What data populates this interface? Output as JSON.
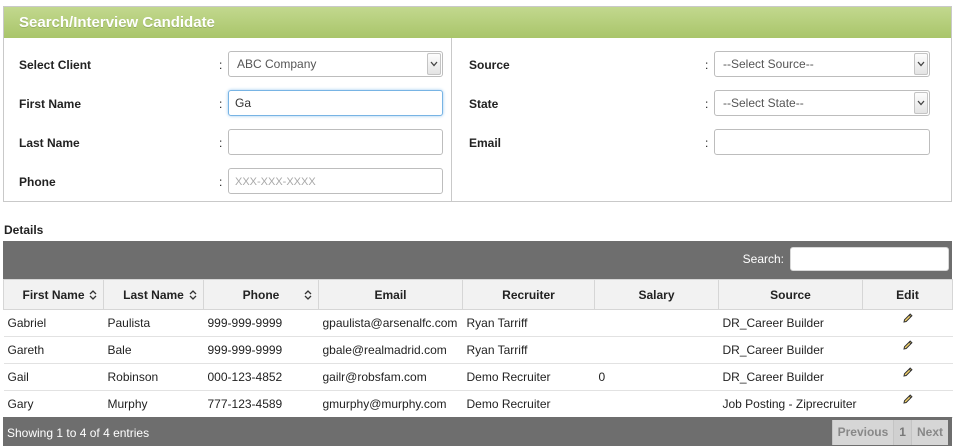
{
  "panel": {
    "title": "Search/Interview Candidate"
  },
  "form": {
    "left": [
      {
        "label": "Select Client",
        "kind": "select",
        "value": "ABC Company"
      },
      {
        "label": "First Name",
        "kind": "input",
        "value": "Ga"
      },
      {
        "label": "Last Name",
        "kind": "input",
        "value": ""
      },
      {
        "label": "Phone",
        "kind": "input",
        "value": "",
        "placeholder": "XXX-XXX-XXXX"
      }
    ],
    "right": [
      {
        "label": "Source",
        "kind": "select",
        "value": "--Select Source--"
      },
      {
        "label": "State",
        "kind": "select",
        "value": "--Select State--"
      },
      {
        "label": "Email",
        "kind": "input",
        "value": ""
      }
    ],
    "colon": ":"
  },
  "details": {
    "label": "Details",
    "search_label": "Search:",
    "columns": [
      "First Name",
      "Last Name",
      "Phone",
      "Email",
      "Recruiter",
      "Salary",
      "Source",
      "Edit"
    ],
    "rows": [
      [
        "Gabriel",
        "Paulista",
        "999-999-9999",
        "gpaulista@arsenalfc.com",
        "Ryan Tarriff",
        "",
        "DR_Career Builder"
      ],
      [
        "Gareth",
        "Bale",
        "999-999-9999",
        "gbale@realmadrid.com",
        "Ryan Tarriff",
        "",
        "DR_Career Builder"
      ],
      [
        "Gail",
        "Robinson",
        "000-123-4852",
        "gailr@robsfam.com",
        "Demo Recruiter",
        "0",
        "DR_Career Builder"
      ],
      [
        "Gary",
        "Murphy",
        "777-123-4589",
        "gmurphy@murphy.com",
        "Demo Recruiter",
        "",
        "Job Posting - Ziprecruiter"
      ]
    ],
    "info": "Showing 1 to 4 of 4 entries",
    "pager": {
      "previous": "Previous",
      "page": "1",
      "next": "Next"
    }
  },
  "icons": {
    "edit": "pencil-icon",
    "sort": "sort-both-icon",
    "dropdown": "chevron-down-icon"
  }
}
